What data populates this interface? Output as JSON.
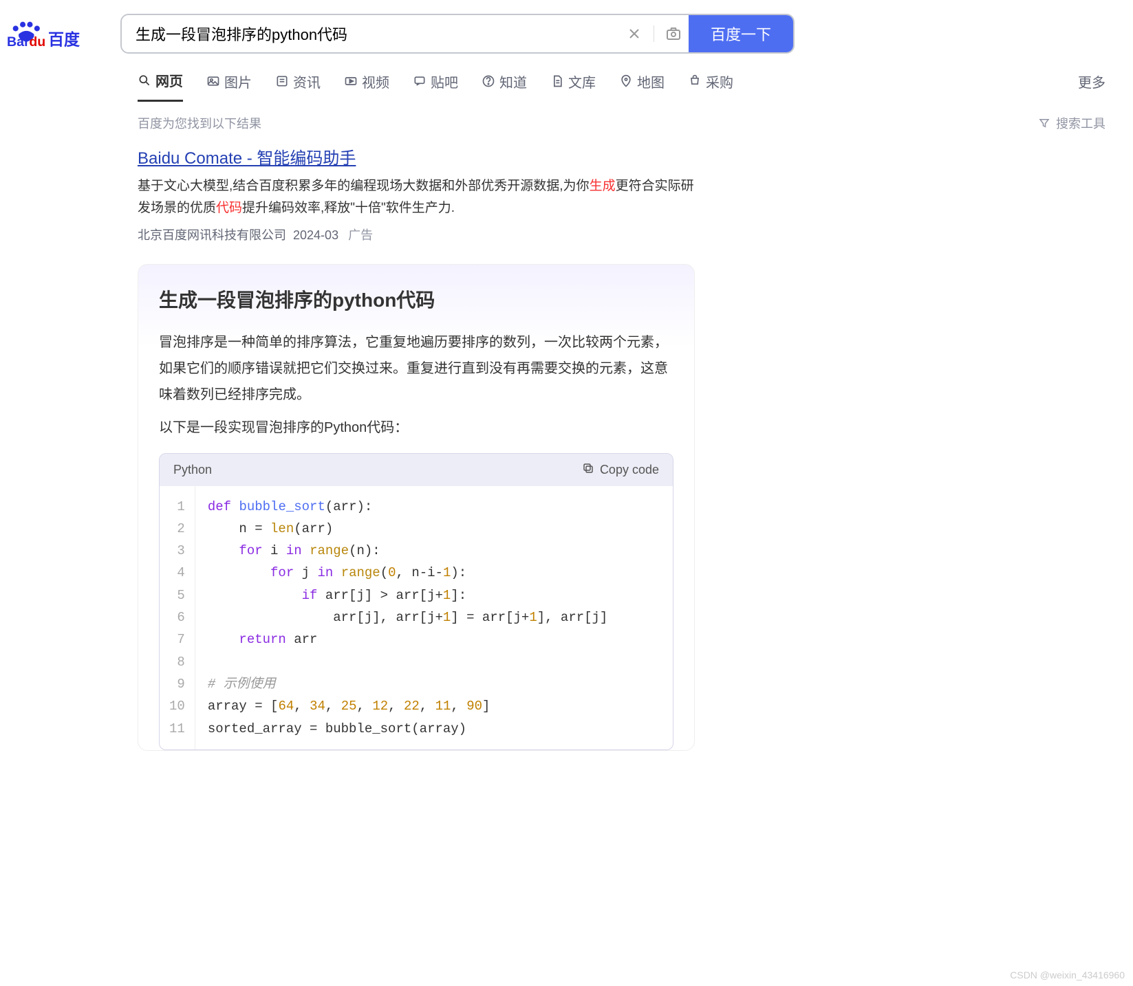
{
  "search": {
    "query": "生成一段冒泡排序的python代码",
    "button_label": "百度一下"
  },
  "tabs": {
    "items": [
      {
        "label": "网页",
        "icon": "search-icon"
      },
      {
        "label": "图片",
        "icon": "image-icon"
      },
      {
        "label": "资讯",
        "icon": "news-icon"
      },
      {
        "label": "视频",
        "icon": "video-icon"
      },
      {
        "label": "贴吧",
        "icon": "tieba-icon"
      },
      {
        "label": "知道",
        "icon": "question-icon"
      },
      {
        "label": "文库",
        "icon": "doc-icon"
      },
      {
        "label": "地图",
        "icon": "map-icon"
      },
      {
        "label": "采购",
        "icon": "cart-icon"
      }
    ],
    "more_label": "更多"
  },
  "meta": {
    "result_hint": "百度为您找到以下结果",
    "tools_label": "搜索工具"
  },
  "ad": {
    "title": "Baidu Comate - 智能编码助手",
    "desc_prefix": "基于文心大模型,结合百度积累多年的编程现场大数据和外部优秀开源数据,为你",
    "desc_em1": "生成",
    "desc_mid": "更符合实际研发场景的优质",
    "desc_em2": "代码",
    "desc_suffix": "提升编码效率,释放\"十倍\"软件生产力.",
    "company": "北京百度网讯科技有限公司",
    "date": "2024-03",
    "ad_tag": "广告"
  },
  "answer": {
    "title": "生成一段冒泡排序的python代码",
    "para1": "冒泡排序是一种简单的排序算法，它重复地遍历要排序的数列，一次比较两个元素，如果它们的顺序错误就把它们交换过来。重复进行直到没有再需要交换的元素，这意味着数列已经排序完成。",
    "para2": "以下是一段实现冒泡排序的Python代码："
  },
  "code": {
    "lang_label": "Python",
    "copy_label": "Copy code",
    "line_count": 11,
    "tokens": [
      [
        [
          "kw",
          "def"
        ],
        [
          "txt",
          " "
        ],
        [
          "fn",
          "bubble_sort"
        ],
        [
          "txt",
          "(arr):"
        ]
      ],
      [
        [
          "txt",
          "    n = "
        ],
        [
          "bi",
          "len"
        ],
        [
          "txt",
          "(arr)"
        ]
      ],
      [
        [
          "txt",
          "    "
        ],
        [
          "kw",
          "for"
        ],
        [
          "txt",
          " i "
        ],
        [
          "kw",
          "in"
        ],
        [
          "txt",
          " "
        ],
        [
          "bi",
          "range"
        ],
        [
          "txt",
          "(n):"
        ]
      ],
      [
        [
          "txt",
          "        "
        ],
        [
          "kw",
          "for"
        ],
        [
          "txt",
          " j "
        ],
        [
          "kw",
          "in"
        ],
        [
          "txt",
          " "
        ],
        [
          "bi",
          "range"
        ],
        [
          "txt",
          "("
        ],
        [
          "num",
          "0"
        ],
        [
          "txt",
          ", n-i-"
        ],
        [
          "num",
          "1"
        ],
        [
          "txt",
          "):"
        ]
      ],
      [
        [
          "txt",
          "            "
        ],
        [
          "kw",
          "if"
        ],
        [
          "txt",
          " arr[j] > arr[j+"
        ],
        [
          "num",
          "1"
        ],
        [
          "txt",
          "]:"
        ]
      ],
      [
        [
          "txt",
          "                arr[j], arr[j+"
        ],
        [
          "num",
          "1"
        ],
        [
          "txt",
          "] = arr[j+"
        ],
        [
          "num",
          "1"
        ],
        [
          "txt",
          "], arr[j]"
        ]
      ],
      [
        [
          "txt",
          "    "
        ],
        [
          "kw",
          "return"
        ],
        [
          "txt",
          " arr"
        ]
      ],
      [],
      [
        [
          "cm",
          "# 示例使用"
        ]
      ],
      [
        [
          "txt",
          "array = ["
        ],
        [
          "num",
          "64"
        ],
        [
          "txt",
          ", "
        ],
        [
          "num",
          "34"
        ],
        [
          "txt",
          ", "
        ],
        [
          "num",
          "25"
        ],
        [
          "txt",
          ", "
        ],
        [
          "num",
          "12"
        ],
        [
          "txt",
          ", "
        ],
        [
          "num",
          "22"
        ],
        [
          "txt",
          ", "
        ],
        [
          "num",
          "11"
        ],
        [
          "txt",
          ", "
        ],
        [
          "num",
          "90"
        ],
        [
          "txt",
          "]"
        ]
      ],
      [
        [
          "txt",
          "sorted_array = bubble_sort(array)"
        ]
      ]
    ]
  },
  "watermark": "CSDN @weixin_43416960"
}
